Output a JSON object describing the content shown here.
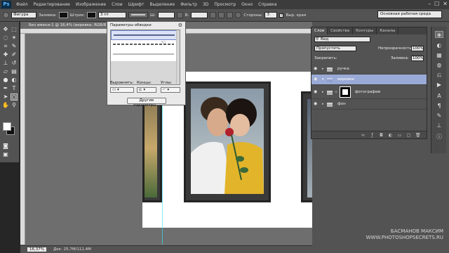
{
  "app": {
    "logo": "Ps"
  },
  "menu": [
    "Файл",
    "Редактирование",
    "Изображение",
    "Слои",
    "Шрифт",
    "Выделение",
    "Фильтр",
    "3D",
    "Просмотр",
    "Окно",
    "Справка"
  ],
  "window_controls": [
    "–",
    "☐",
    "✕"
  ],
  "options": {
    "shape_mode": "Фигура",
    "fill_label": "Заливка:",
    "stroke_label": "Штрих:",
    "stroke_size": "3 пт",
    "w_label": "Ш:",
    "h_label": "В:",
    "sides_label": "Стороны:",
    "sides_value": "3",
    "align_edges_label": "Выр. края",
    "workspace": "Основная рабочая среда"
  },
  "document": {
    "tab_title": "Без имени-1 @ 16,4% (веревки, RGB/8) *",
    "zoom": "16,37%",
    "doc_info": "Док: 25,7M/111,4M"
  },
  "stroke_popup": {
    "title": "Параметры обводки",
    "align_label": "Выровнять:",
    "caps_label": "Концы:",
    "corners_label": "Углы:",
    "more_button": "Другие параметры..."
  },
  "layers_panel": {
    "tabs": [
      "Слои",
      "Свойства",
      "Контуры",
      "Каналы"
    ],
    "kind_label": "Вид",
    "blend_mode": "Пропустить",
    "opacity_label": "Непрозрачность:",
    "opacity_value": "100%",
    "lock_label": "Закрепить:",
    "fill_label": "Заливка:",
    "fill_value": "100%",
    "layers": [
      {
        "name": "ручка",
        "selected": false
      },
      {
        "name": "веревки",
        "selected": true
      },
      {
        "name": "фотографии",
        "selected": false
      },
      {
        "name": "фон",
        "selected": false
      }
    ]
  },
  "watermark": {
    "line1": "БАСМАНОВ МАКСИМ",
    "line2": "WWW.PHOTOSHOPSECRETS.RU"
  },
  "colors": {
    "selected_layer": "#9aaad6",
    "guide": "#2ee9ff",
    "ps_logo": "#5fb6ff"
  }
}
